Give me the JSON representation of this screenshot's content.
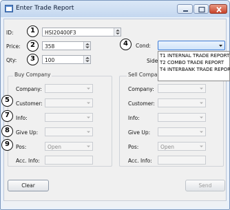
{
  "window": {
    "title": "Enter Trade Report"
  },
  "header": {
    "id_label": "ID:",
    "id_value": "HSI20400F3",
    "price_label": "Price:",
    "price_value": "358",
    "qty_label": "Qty:",
    "qty_value": "100",
    "cond_label": "Cond:",
    "cond_value": "",
    "side_label": "Side:"
  },
  "cond_options": [
    "T1 INTERNAL TRADE REPORT",
    "T2 COMBO TRADE REPORT",
    "T4 INTERBANK TRADE REPORT"
  ],
  "buy": {
    "title": "Buy Company",
    "company_label": "Company:",
    "customer_label": "Customer:",
    "info_label": "Info:",
    "giveup_label": "Give Up:",
    "pos_label": "Pos:",
    "pos_value": "Open",
    "accinfo_label": "Acc. Info:"
  },
  "sell": {
    "title": "Sell Company",
    "company_label": "Company:",
    "customer_label": "Customer:",
    "info_label": "Info:",
    "giveup_label": "Give Up:",
    "pos_label": "Pos:",
    "pos_value": "Open",
    "accinfo_label": "Acc. Info:"
  },
  "badges": [
    "1",
    "2",
    "3",
    "4",
    "5",
    "7",
    "8",
    "9"
  ],
  "buttons": {
    "clear": "Clear",
    "send": "Send"
  },
  "colors": {
    "accent": "#3d7bd6",
    "close": "#c7422a"
  }
}
